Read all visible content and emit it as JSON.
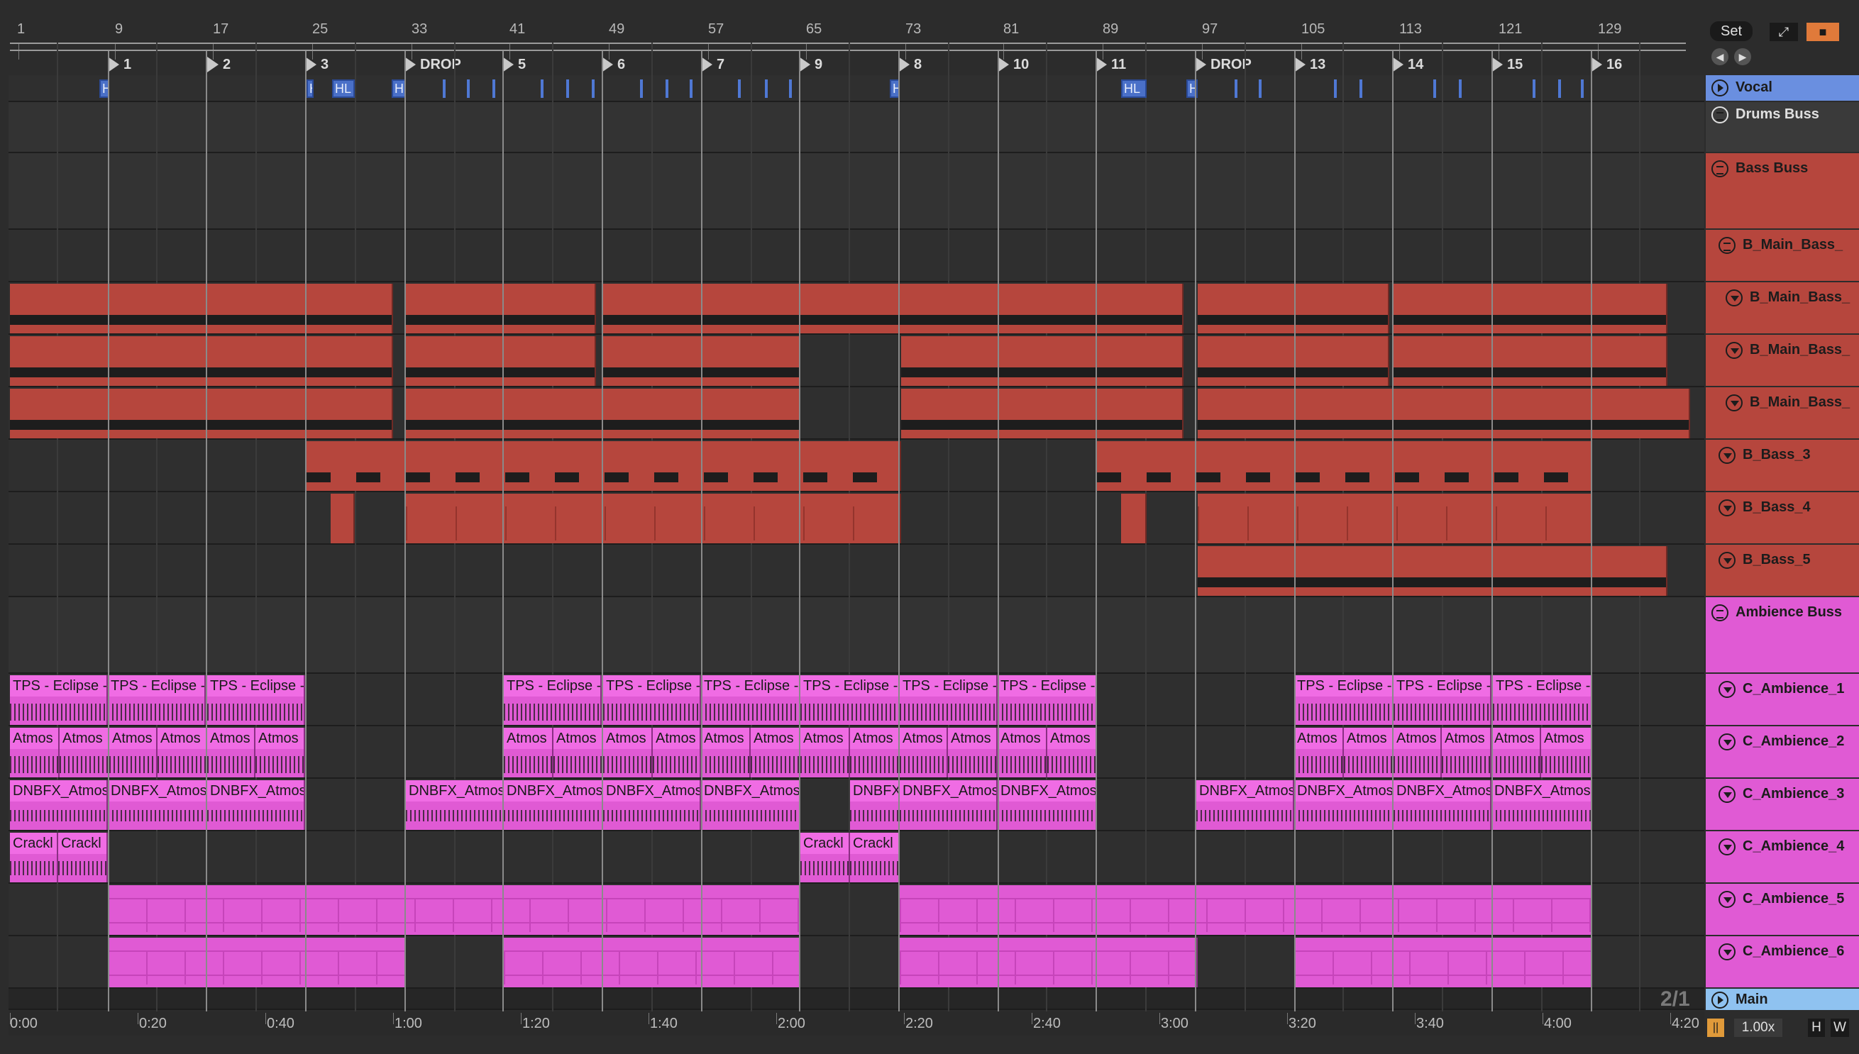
{
  "ruler": {
    "bars": [
      "1",
      "9",
      "17",
      "25",
      "33",
      "41",
      "49",
      "57",
      "65",
      "73",
      "81",
      "89",
      "97",
      "105",
      "113",
      "121",
      "129"
    ]
  },
  "locators": [
    "1",
    "2",
    "3",
    "DROP",
    "5",
    "6",
    "7",
    "9",
    "8",
    "10",
    "11",
    "DROP",
    "13",
    "14",
    "15",
    "16"
  ],
  "top_right": {
    "set_label": "Set"
  },
  "vocal_clips": [
    "H",
    "H",
    "HL",
    "H",
    "H",
    "HL",
    "H"
  ],
  "clip_names": {
    "tps": "TPS - Eclipse -",
    "atmos": "Atmos",
    "dnbfx": "DNBFX_Atmos",
    "dnbfx_short": "DNBFX",
    "crackle": "Crackl"
  },
  "tracks": [
    {
      "name": "Vocal",
      "icon": "play-icon"
    },
    {
      "name": "Drums Buss",
      "icon": "group-icon"
    },
    {
      "name": "Bass Buss",
      "icon": "group-icon"
    },
    {
      "name": "B_Main_Bass_",
      "icon": "group-icon"
    },
    {
      "name": "B_Main_Bass_",
      "icon": "chevron-down-icon"
    },
    {
      "name": "B_Main_Bass_",
      "icon": "chevron-down-icon"
    },
    {
      "name": "B_Main_Bass_",
      "icon": "chevron-down-icon"
    },
    {
      "name": "B_Bass_3",
      "icon": "chevron-down-icon"
    },
    {
      "name": "B_Bass_4",
      "icon": "chevron-down-icon"
    },
    {
      "name": "B_Bass_5",
      "icon": "chevron-down-icon"
    },
    {
      "name": "Ambience Buss",
      "icon": "group-icon"
    },
    {
      "name": "C_Ambience_1",
      "icon": "chevron-down-icon"
    },
    {
      "name": "C_Ambience_2",
      "icon": "chevron-down-icon"
    },
    {
      "name": "C_Ambience_3",
      "icon": "chevron-down-icon"
    },
    {
      "name": "C_Ambience_4",
      "icon": "chevron-down-icon"
    },
    {
      "name": "C_Ambience_5",
      "icon": "chevron-down-icon"
    },
    {
      "name": "C_Ambience_6",
      "icon": "chevron-down-icon"
    },
    {
      "name": "Main",
      "icon": "play-icon"
    }
  ],
  "time_labels": [
    "0:00",
    "0:20",
    "0:40",
    "1:00",
    "1:20",
    "1:40",
    "2:00",
    "2:20",
    "2:40",
    "3:00",
    "3:20",
    "3:40",
    "4:00",
    "4:20"
  ],
  "footer": {
    "grid": "2/1",
    "zoom": "1.00x",
    "h_label": "H",
    "w_label": "W"
  },
  "colors": {
    "bass": "#b6463d",
    "ambience": "#e05ad4",
    "vocal": "#4a70c8",
    "background": "#2c2c2c"
  }
}
